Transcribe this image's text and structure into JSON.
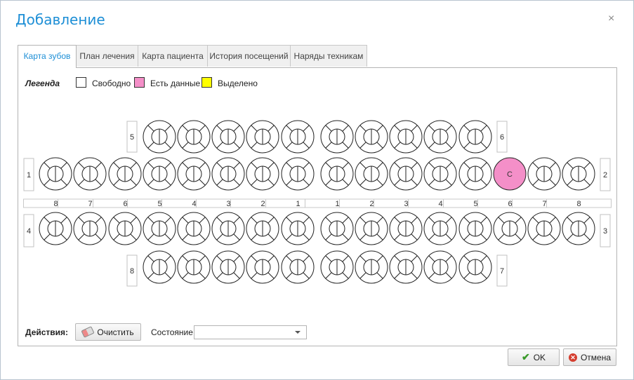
{
  "window": {
    "title": "Добавление",
    "close_glyph": "×"
  },
  "tabs": [
    {
      "label": "Карта зубов",
      "active": true
    },
    {
      "label": "План лечения",
      "active": false
    },
    {
      "label": "Карта пациента",
      "active": false
    },
    {
      "label": "История посещений",
      "active": false
    },
    {
      "label": "Наряды техникам",
      "active": false
    }
  ],
  "legend": {
    "title": "Легенда",
    "items": [
      {
        "label": "Свободно",
        "color": "#ffffff"
      },
      {
        "label": "Есть данные",
        "color": "#f48fc8"
      },
      {
        "label": "Выделено",
        "color": "#ffff00"
      }
    ]
  },
  "quadrant_labels": {
    "upper_left": "1",
    "upper_right": "2",
    "lower_right": "3",
    "lower_left": "4",
    "child_upper_left": "5",
    "child_upper_right": "6",
    "child_lower_right": "7",
    "child_lower_left": "8"
  },
  "tooth_numbers_left": [
    "8",
    "7",
    "6",
    "5",
    "4",
    "3",
    "2",
    "1"
  ],
  "tooth_numbers_right": [
    "1",
    "2",
    "3",
    "4",
    "5",
    "6",
    "7",
    "8"
  ],
  "teeth_marks": {
    "upper_right_6": {
      "mark": "C",
      "status": "has_data"
    }
  },
  "actions": {
    "label": "Действия:",
    "clear_label": "Очистить",
    "state_label": "Состояние",
    "state_value": ""
  },
  "footer": {
    "ok_label": "OK",
    "cancel_label": "Отмена"
  },
  "colors": {
    "accent": "#1e8fd6",
    "has_data": "#f48fc8",
    "selected": "#ffff00"
  }
}
